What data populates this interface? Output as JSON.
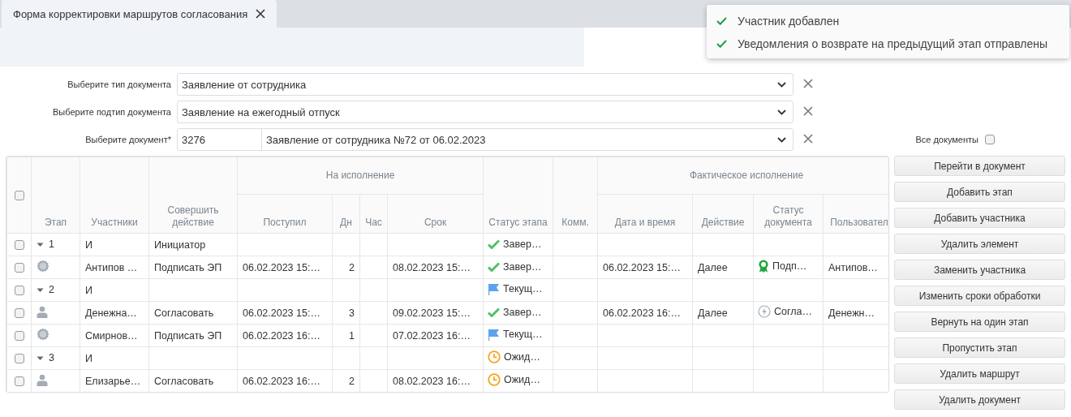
{
  "tab": {
    "title": "Форма корректировки маршрутов согласования"
  },
  "toast": {
    "messages": [
      "Участник добавлен",
      "Уведомления о возврате на предыдущий этап отправлены"
    ]
  },
  "form": {
    "fields": [
      {
        "label": "Выберите тип документа",
        "value": "Заявление от сотрудника"
      },
      {
        "label": "Выберите подтип документа",
        "value": "Заявление на ежегодный отпуск"
      },
      {
        "label": "Выберите документ*",
        "code": "3276",
        "value": "Заявление от сотрудника №72 от 06.02.2023"
      }
    ],
    "all_documents": {
      "label": "Все документы",
      "checked": false
    }
  },
  "table": {
    "select_all_checked": false,
    "group_headers": [
      "На исполнение",
      "Фактическое исполнение"
    ],
    "columns": [
      "Этап",
      "Участники",
      "Совершить действие",
      "Поступил",
      "Дн",
      "Час",
      "Срок",
      "Статус этапа",
      "Комм.",
      "Дата и время",
      "Действие",
      "Статус документа",
      "Пользовател"
    ],
    "rows": [
      {
        "kind": "stage",
        "checked": false,
        "expanded": true,
        "stage": "1",
        "participant": "И",
        "action": "Инициатор",
        "stage_status": {
          "kind": "done",
          "text": "Завер…"
        }
      },
      {
        "kind": "seal",
        "checked": false,
        "participant": "Антипов …",
        "action": "Подписать ЭП",
        "received": "06.02.2023 15:…",
        "days": "2",
        "due": "08.02.2023 15:…",
        "stage_status": {
          "kind": "done",
          "text": "Завер…"
        },
        "done_at": "06.02.2023 15:…",
        "done_action": "Далее",
        "doc_status": {
          "kind": "award",
          "text": "Подп…"
        },
        "user": "Антипов…"
      },
      {
        "kind": "stage",
        "checked": false,
        "expanded": true,
        "stage": "2",
        "participant": "И",
        "stage_status": {
          "kind": "current",
          "text": "Текущ…"
        }
      },
      {
        "kind": "person",
        "checked": false,
        "participant": "Денежна…",
        "action": "Согласовать",
        "received": "06.02.2023 15:…",
        "days": "3",
        "due": "09.02.2023 15:…",
        "stage_status": {
          "kind": "done",
          "text": "Завер…"
        },
        "done_at": "06.02.2023 16:…",
        "done_action": "Далее",
        "doc_status": {
          "kind": "lightning",
          "text": "Согла…"
        },
        "user": "Денежн…"
      },
      {
        "kind": "seal",
        "checked": false,
        "participant": "Смирнов…",
        "action": "Подписать ЭП",
        "received": "06.02.2023 16:…",
        "days": "1",
        "due": "07.02.2023 16:…",
        "stage_status": {
          "kind": "current",
          "text": "Текущ…"
        }
      },
      {
        "kind": "stage",
        "checked": false,
        "expanded": true,
        "stage": "3",
        "participant": "И",
        "stage_status": {
          "kind": "waiting",
          "text": "Ожид…"
        }
      },
      {
        "kind": "person",
        "checked": false,
        "participant": "Елизарье…",
        "action": "Согласовать",
        "received": "06.02.2023 16:…",
        "days": "2",
        "due": "08.02.2023 16:…",
        "stage_status": {
          "kind": "waiting",
          "text": "Ожид…"
        }
      }
    ]
  },
  "buttons": [
    "Перейти в документ",
    "Добавить этап",
    "Добавить участника",
    "Удалить элемент",
    "Заменить участника",
    "Изменить сроки обработки",
    "Вернуть на один этап",
    "Пропустить этап",
    "Удалить маршрут",
    "Удалить документ"
  ]
}
